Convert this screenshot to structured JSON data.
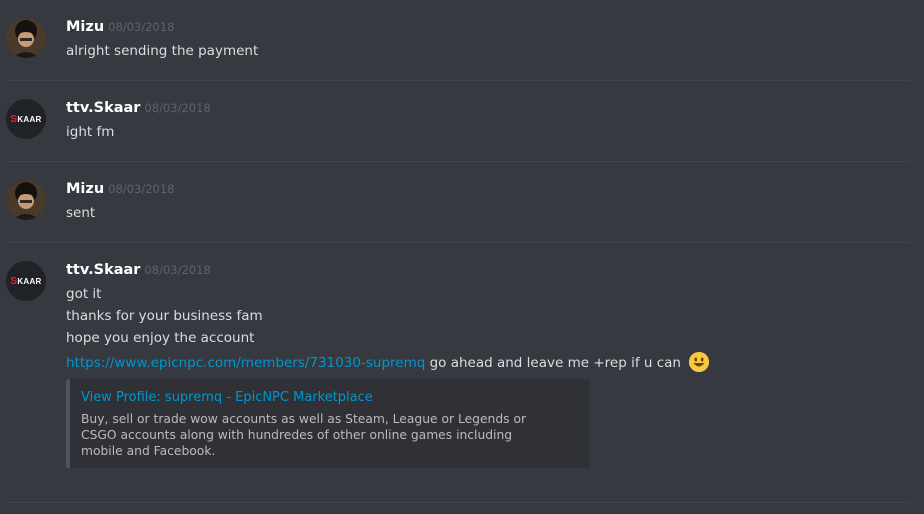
{
  "messages": [
    {
      "author": "Mizu",
      "timestamp": "08/03/2018",
      "lines": [
        "alright sending the payment"
      ]
    },
    {
      "author": "ttv.Skaar",
      "timestamp": "08/03/2018",
      "lines": [
        "ight fm"
      ]
    },
    {
      "author": "Mizu",
      "timestamp": "08/03/2018",
      "lines": [
        "sent"
      ]
    },
    {
      "author": "ttv.Skaar",
      "timestamp": "08/03/2018",
      "lines": [
        "got it",
        "thanks for your business fam",
        "hope you enjoy the account"
      ],
      "link_url": "https://www.epicnpc.com/members/731030-supremq",
      "link_suffix": "go ahead and leave me +rep if u can",
      "embed": {
        "title": "View Profile: supremq - EpicNPC Marketplace",
        "description": "Buy, sell or trade wow accounts as well as Steam, League or Legends or CSGO accounts along with hundredes of other online games including mobile and Facebook."
      }
    }
  ],
  "avatars": {
    "skaar_logo_s": "S",
    "skaar_logo_rest": "KAAR"
  },
  "colors": {
    "background": "#36393f",
    "link": "#0096cf",
    "username": "#ffffff",
    "timestamp": "#5f6269"
  }
}
